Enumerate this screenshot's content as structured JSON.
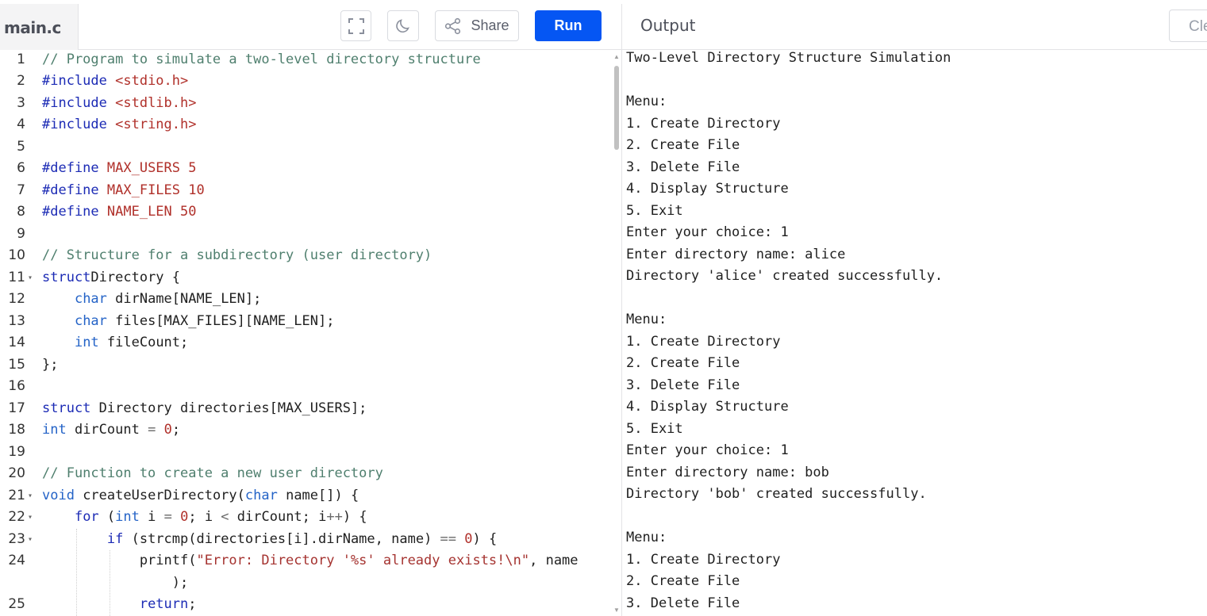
{
  "editor": {
    "tab_label": "main.c",
    "lines": [
      {
        "n": "1",
        "fold": false,
        "tokens": [
          [
            "cm",
            "// Program to simulate a two-level directory structure"
          ]
        ]
      },
      {
        "n": "2",
        "fold": false,
        "tokens": [
          [
            "pp",
            "#include "
          ],
          [
            "inc",
            "<stdio.h>"
          ]
        ]
      },
      {
        "n": "3",
        "fold": false,
        "tokens": [
          [
            "pp",
            "#include "
          ],
          [
            "inc",
            "<stdlib.h>"
          ]
        ]
      },
      {
        "n": "4",
        "fold": false,
        "tokens": [
          [
            "pp",
            "#include "
          ],
          [
            "inc",
            "<string.h>"
          ]
        ]
      },
      {
        "n": "5",
        "fold": false,
        "tokens": []
      },
      {
        "n": "6",
        "fold": false,
        "tokens": [
          [
            "pp",
            "#define "
          ],
          [
            "mac",
            "MAX_USERS 5"
          ]
        ]
      },
      {
        "n": "7",
        "fold": false,
        "tokens": [
          [
            "pp",
            "#define "
          ],
          [
            "mac",
            "MAX_FILES 10"
          ]
        ]
      },
      {
        "n": "8",
        "fold": false,
        "tokens": [
          [
            "pp",
            "#define "
          ],
          [
            "mac",
            "NAME_LEN 50"
          ]
        ]
      },
      {
        "n": "9",
        "fold": false,
        "tokens": []
      },
      {
        "n": "10",
        "fold": false,
        "tokens": [
          [
            "cm",
            "// Structure for a subdirectory (user directory)"
          ]
        ]
      },
      {
        "n": "11",
        "fold": true,
        "tokens": [
          [
            "kw",
            "struct"
          ],
          [
            "",
            "Directory {"
          ]
        ]
      },
      {
        "n": "12",
        "fold": false,
        "tokens": [
          [
            "",
            "    "
          ],
          [
            "ty",
            "char"
          ],
          [
            "",
            " dirName[NAME_LEN];"
          ]
        ]
      },
      {
        "n": "13",
        "fold": false,
        "tokens": [
          [
            "",
            "    "
          ],
          [
            "ty",
            "char"
          ],
          [
            "",
            " files[MAX_FILES][NAME_LEN];"
          ]
        ]
      },
      {
        "n": "14",
        "fold": false,
        "tokens": [
          [
            "",
            "    "
          ],
          [
            "ty",
            "int"
          ],
          [
            "",
            " fileCount;"
          ]
        ]
      },
      {
        "n": "15",
        "fold": false,
        "tokens": [
          [
            "",
            "};"
          ]
        ]
      },
      {
        "n": "16",
        "fold": false,
        "tokens": []
      },
      {
        "n": "17",
        "fold": false,
        "tokens": [
          [
            "kw",
            "struct"
          ],
          [
            "",
            " Directory directories[MAX_USERS];"
          ]
        ]
      },
      {
        "n": "18",
        "fold": false,
        "tokens": [
          [
            "ty",
            "int"
          ],
          [
            "",
            " dirCount "
          ],
          [
            "op",
            "="
          ],
          [
            "",
            " "
          ],
          [
            "num",
            "0"
          ],
          [
            "",
            ";"
          ]
        ]
      },
      {
        "n": "19",
        "fold": false,
        "tokens": []
      },
      {
        "n": "20",
        "fold": false,
        "tokens": [
          [
            "cm",
            "// Function to create a new user directory"
          ]
        ]
      },
      {
        "n": "21",
        "fold": true,
        "tokens": [
          [
            "ty",
            "void"
          ],
          [
            "",
            " createUserDirectory("
          ],
          [
            "ty",
            "char"
          ],
          [
            "",
            " name[]) {"
          ]
        ]
      },
      {
        "n": "22",
        "fold": true,
        "tokens": [
          [
            "",
            "    "
          ],
          [
            "kw",
            "for"
          ],
          [
            "",
            " ("
          ],
          [
            "ty",
            "int"
          ],
          [
            "",
            " i "
          ],
          [
            "op",
            "="
          ],
          [
            "",
            " "
          ],
          [
            "num",
            "0"
          ],
          [
            "",
            "; i "
          ],
          [
            "op",
            "<"
          ],
          [
            "",
            " dirCount; i"
          ],
          [
            "op",
            "++"
          ],
          [
            "",
            ") {"
          ]
        ]
      },
      {
        "n": "23",
        "fold": true,
        "tokens": [
          [
            "",
            "        "
          ],
          [
            "kw",
            "if"
          ],
          [
            "",
            " (strcmp(directories[i].dirName, name) "
          ],
          [
            "op",
            "=="
          ],
          [
            "",
            " "
          ],
          [
            "num",
            "0"
          ],
          [
            "",
            ") {"
          ]
        ]
      },
      {
        "n": "24",
        "fold": false,
        "tokens": [
          [
            "",
            "            printf("
          ],
          [
            "str",
            "\"Error: Directory '%s' already exists!\\n\""
          ],
          [
            "",
            ", name"
          ]
        ]
      },
      {
        "n": "",
        "fold": false,
        "tokens": [
          [
            "",
            "                );"
          ]
        ]
      },
      {
        "n": "25",
        "fold": false,
        "tokens": [
          [
            "",
            "            "
          ],
          [
            "kw",
            "return"
          ],
          [
            "",
            ";"
          ]
        ]
      }
    ]
  },
  "toolbar": {
    "fullscreen_icon": "fullscreen-icon",
    "theme_icon": "moon-icon",
    "share_label": "Share",
    "share_icon": "share-icon",
    "run_label": "Run",
    "run_color": "#0556f3"
  },
  "output": {
    "title": "Output",
    "clear_label": "Clear",
    "lines": [
      "Two-Level Directory Structure Simulation",
      "",
      "Menu:",
      "1. Create Directory",
      "2. Create File",
      "3. Delete File",
      "4. Display Structure",
      "5. Exit",
      "Enter your choice: 1",
      "Enter directory name: alice",
      "Directory 'alice' created successfully.",
      "",
      "Menu:",
      "1. Create Directory",
      "2. Create File",
      "3. Delete File",
      "4. Display Structure",
      "5. Exit",
      "Enter your choice: 1",
      "Enter directory name: bob",
      "Directory 'bob' created successfully.",
      "",
      "Menu:",
      "1. Create Directory",
      "2. Create File",
      "3. Delete File"
    ]
  }
}
